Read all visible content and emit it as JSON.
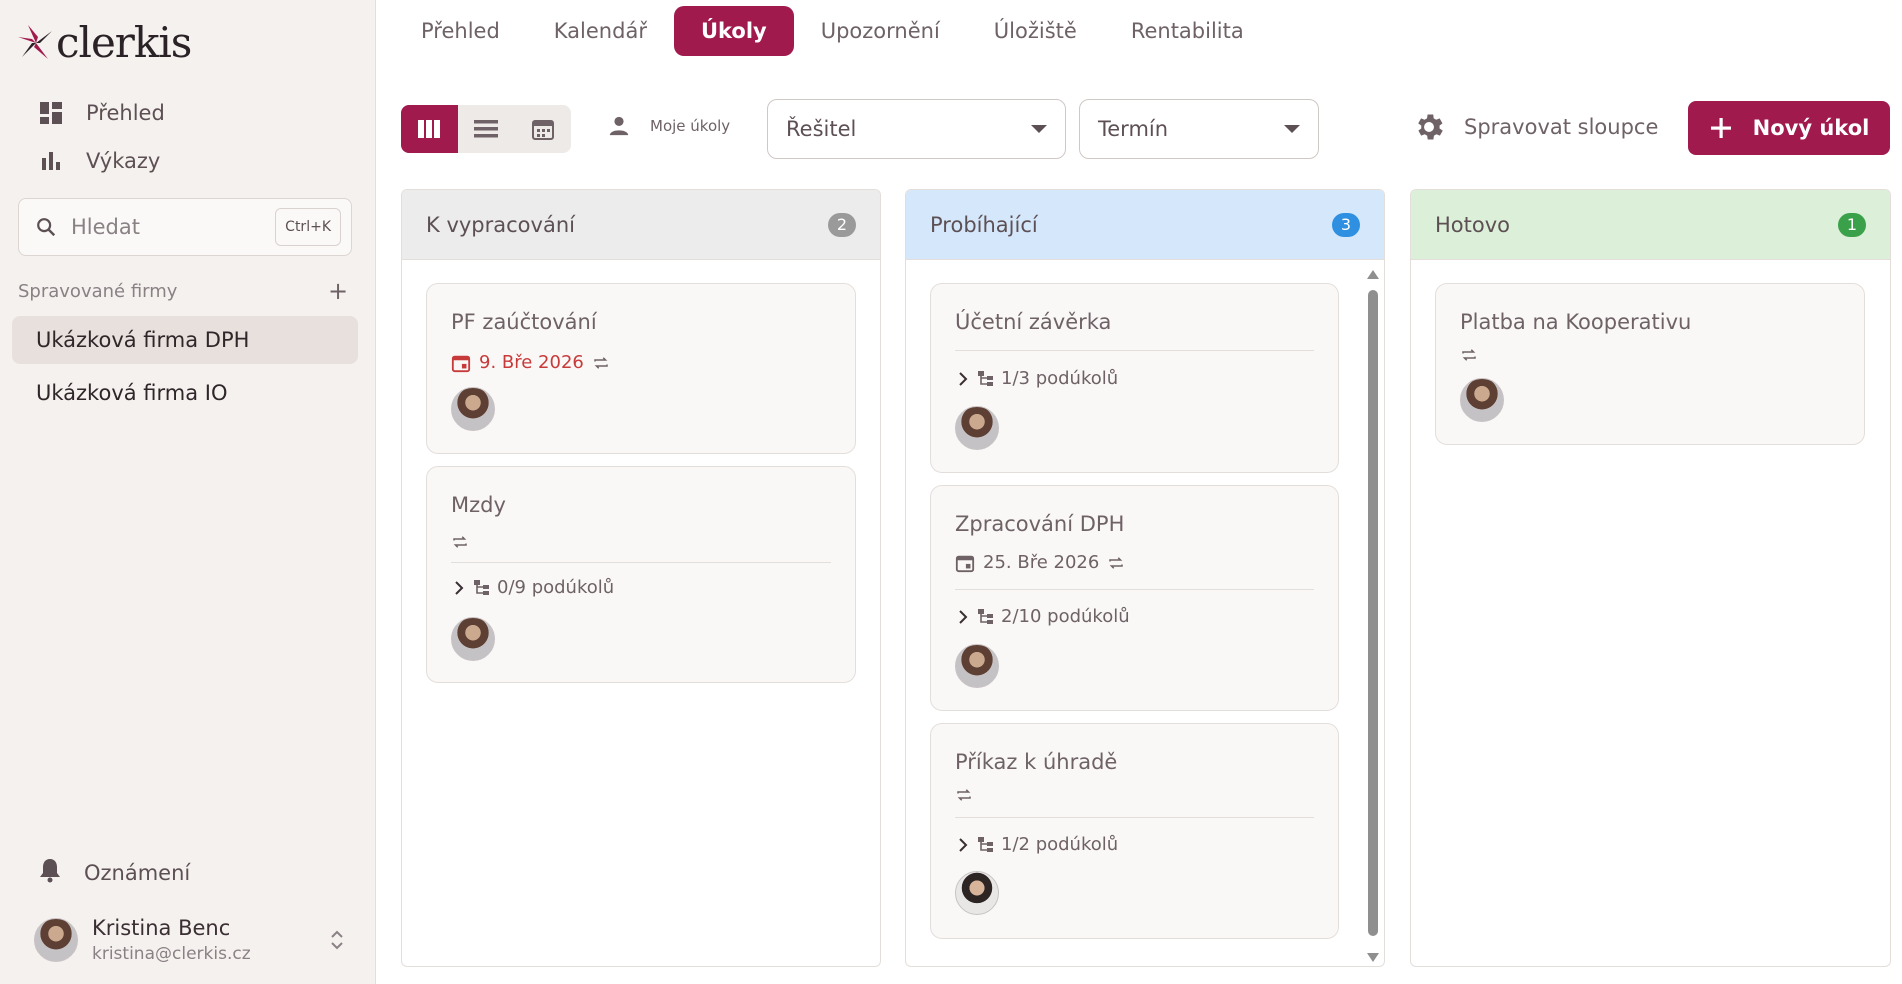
{
  "brand": {
    "logo_text": "clerkis",
    "accent": "#a01a4e"
  },
  "sidebar": {
    "nav": [
      {
        "label": "Přehled",
        "icon": "dashboard-icon"
      },
      {
        "label": "Výkazy",
        "icon": "bar-chart-icon"
      }
    ],
    "search": {
      "placeholder": "Hledat",
      "shortcut": "Ctrl+K"
    },
    "firms_section": {
      "title": "Spravované firmy"
    },
    "firms": [
      {
        "label": "Ukázková firma DPH",
        "active": true
      },
      {
        "label": "Ukázková firma IO",
        "active": false
      }
    ],
    "notifications": {
      "label": "Oznámení"
    },
    "user": {
      "name": "Kristina Benc",
      "email": "kristina@clerkis.cz"
    }
  },
  "tabs": [
    {
      "label": "Přehled",
      "active": false
    },
    {
      "label": "Kalendář",
      "active": false
    },
    {
      "label": "Úkoly",
      "active": true
    },
    {
      "label": "Upozornění",
      "active": false
    },
    {
      "label": "Úložiště",
      "active": false
    },
    {
      "label": "Rentabilita",
      "active": false
    }
  ],
  "toolbar": {
    "view_modes": [
      "board",
      "list",
      "calendar"
    ],
    "active_view": "board",
    "my_tasks_label": "Moje úkoly",
    "assignee_select": "Řešitel",
    "due_select": "Termín",
    "manage_columns_label": "Spravovat sloupce",
    "new_task_label": "Nový úkol"
  },
  "columns": [
    {
      "title": "K vypracování",
      "count": "2",
      "header_bg": "#ececec",
      "badge_color": "#9a9a9a",
      "cards": [
        {
          "title": "PF zaúčtování",
          "due": "9. Bře 2026",
          "overdue": true,
          "recurring": true,
          "subtasks": ""
        },
        {
          "title": "Mzdy",
          "due": "",
          "overdue": false,
          "recurring": true,
          "subtasks": "0/9 podúkolů"
        }
      ]
    },
    {
      "title": "Probíhající",
      "count": "3",
      "header_bg": "#d5e8fb",
      "badge_color": "#2f8fe0",
      "cards": [
        {
          "title": "Účetní závěrka",
          "due": "",
          "recurring": false,
          "subtasks": "1/3 podúkolů"
        },
        {
          "title": "Zpracování DPH",
          "due": "25. Bře 2026",
          "overdue": false,
          "recurring": true,
          "subtasks": "2/10 podúkolů"
        },
        {
          "title": "Příkaz k úhradě",
          "due": "",
          "recurring": true,
          "subtasks": "1/2 podúkolů"
        }
      ]
    },
    {
      "title": "Hotovo",
      "count": "1",
      "header_bg": "#dcefd8",
      "badge_color": "#3aa14a",
      "cards": [
        {
          "title": "Platba na Kooperativu",
          "due": "",
          "recurring": true,
          "subtasks": ""
        }
      ]
    }
  ]
}
